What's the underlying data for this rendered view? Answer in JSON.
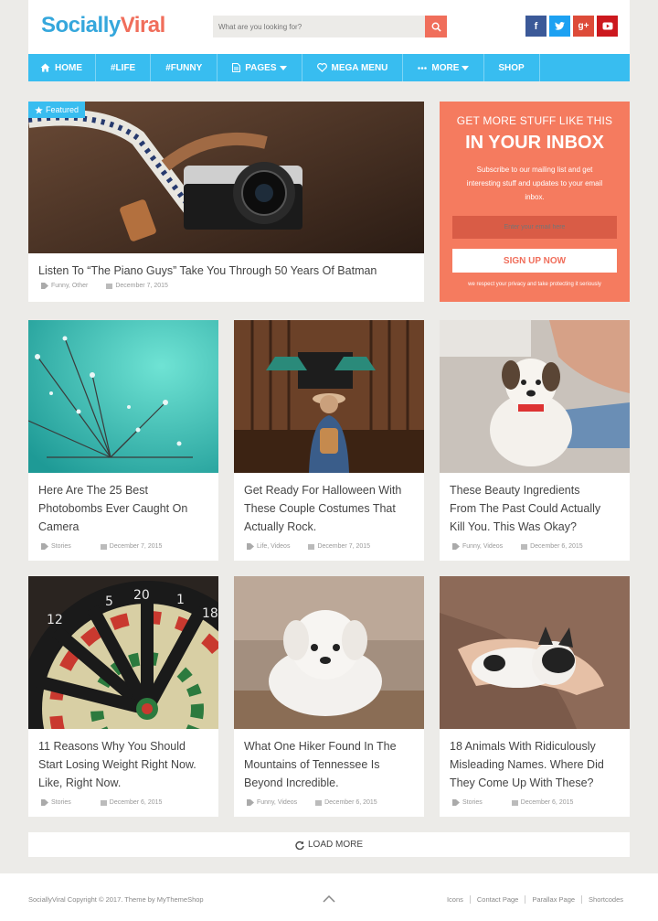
{
  "logo": {
    "part1": "Socially",
    "part2": "Viral"
  },
  "search": {
    "placeholder": "What are you looking for?"
  },
  "social": [
    "f",
    "t",
    "g+",
    "yt"
  ],
  "nav": [
    {
      "label": "HOME",
      "icon": "home-icon"
    },
    {
      "label": "#LIFE",
      "icon": ""
    },
    {
      "label": "#FUNNY",
      "icon": ""
    },
    {
      "label": "PAGES",
      "icon": "page-icon",
      "dropdown": true
    },
    {
      "label": "MEGA MENU",
      "icon": "heart-icon"
    },
    {
      "label": "MORE",
      "icon": "dots-icon",
      "dropdown": true
    },
    {
      "label": "SHOP",
      "icon": ""
    }
  ],
  "featured": {
    "badge": "Featured",
    "title": "Listen To “The Piano Guys” Take You Through 50 Years Of Batman",
    "categories": "Funny, Other",
    "date": "December 7, 2015"
  },
  "newsletter": {
    "heading1": "GET MORE STUFF LIKE THIS",
    "heading2": "IN YOUR INBOX",
    "text": "Subscribe to our mailing list and get interesting stuff and updates to your email inbox.",
    "email_placeholder": "Enter your email here",
    "button": "SIGN UP NOW",
    "note": "we respect your privacy and take protecting it seriously"
  },
  "posts": [
    {
      "line1": "Here Are The 25 Best",
      "line2": "Photobombs Ever Caught On",
      "line3": "Camera",
      "categories": "Stories",
      "date": "December 7, 2015"
    },
    {
      "line1": "Get Ready For Halloween With",
      "line2": "These Couple Costumes That",
      "line3": "Actually Rock.",
      "categories": "Life, Videos",
      "date": "December 7, 2015"
    },
    {
      "line1": "These Beauty Ingredients",
      "line2": "From The Past Could Actually",
      "line3": "Kill You. This Was Okay?",
      "categories": "Funny, Videos",
      "date": "December 6, 2015"
    },
    {
      "line1": "11 Reasons Why You Should",
      "line2": "Start Losing Weight Right Now.",
      "line3": "Like, Right Now.",
      "categories": "Stories",
      "date": "December 6, 2015"
    },
    {
      "line1": "What One Hiker Found In The",
      "line2": "Mountains of Tennessee Is",
      "line3": "Beyond Incredible.",
      "categories": "Funny, Videos",
      "date": "December 6, 2015"
    },
    {
      "line1": "18 Animals With Ridiculously",
      "line2": "Misleading Names. Where Did",
      "line3": "They Come Up With These?",
      "categories": "Stories",
      "date": "December 6, 2015"
    }
  ],
  "load_more": "LOAD MORE",
  "footer": {
    "copyright": "SociallyViral Copyright © 2017. Theme by MyThemeShop",
    "links": [
      "Icons",
      "Contact Page",
      "Parallax Page",
      "Shortcodes"
    ]
  },
  "colors": {
    "accent": "#38bdf0",
    "brand_orange": "#f06e5b",
    "newsletter_bg": "#f57b5f"
  }
}
